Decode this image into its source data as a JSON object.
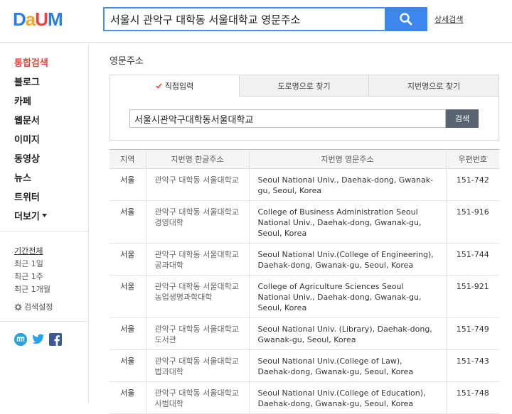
{
  "header": {
    "logo_letters": [
      "D",
      "a",
      "U",
      "M"
    ],
    "logo_colors": [
      "#2a7de1",
      "#f5a623",
      "#e8423f",
      "#2a7de1"
    ],
    "query": "서울시 관악구 대학동 서울대학교 영문주소",
    "detail_link": "상세검색",
    "accent": "#3d86ee"
  },
  "sidebar": {
    "nav": [
      {
        "label": "통합검색",
        "active": true
      },
      {
        "label": "블로그"
      },
      {
        "label": "카페"
      },
      {
        "label": "웹문서"
      },
      {
        "label": "이미지"
      },
      {
        "label": "동영상"
      },
      {
        "label": "뉴스"
      },
      {
        "label": "트위터"
      },
      {
        "label": "더보기"
      }
    ],
    "period_title": "기간전체",
    "periods": [
      "최근 1일",
      "최근 1주",
      "최근 1개월"
    ],
    "settings": "검색설정",
    "social_icons": [
      "mypeople-icon",
      "twitter-icon",
      "facebook-icon"
    ]
  },
  "main": {
    "section_title": "영문주소",
    "tabs": [
      {
        "label": "직접입력",
        "active": true
      },
      {
        "label": "도로명으로 찾기"
      },
      {
        "label": "지번명으로 찾기"
      }
    ],
    "address_input": "서울시관악구대학동서울대학교",
    "search_button": "검색",
    "table": {
      "headers": [
        "지역",
        "지번명 한글주소",
        "지번명 영문주소",
        "우편번호"
      ],
      "rows": [
        [
          "서울",
          "관악구 대학동 서울대학교",
          "Seoul National Univ., Daehak-dong, Gwanak-gu, Seoul, Korea",
          "151-742"
        ],
        [
          "서울",
          "관악구 대학동 서울대학교경영대학",
          "College of Business Administration Seoul National Univ., Daehak-dong, Gwanak-gu, Seoul, Korea",
          "151-916"
        ],
        [
          "서울",
          "관악구 대학동 서울대학교공과대학",
          "Seoul National Univ.(College of Engineering), Daehak-dong, Gwanak-gu, Seoul, Korea",
          "151-744"
        ],
        [
          "서울",
          "관악구 대학동 서울대학교농업생명과학대학",
          "College of Agriculture Sciences Seoul National Univ., Daehak-dong, Gwanak-gu, Seoul, Korea",
          "151-921"
        ],
        [
          "서울",
          "관악구 대학동 서울대학교도서관",
          "Seoul National Univ. (Library), Daehak-dong, Gwanak-gu, Seoul, Korea",
          "151-749"
        ],
        [
          "서울",
          "관악구 대학동 서울대학교법과대학",
          "Seoul National Univ.(College of Law), Daehak-dong, Gwanak-gu, Seoul, Korea",
          "151-743"
        ],
        [
          "서울",
          "관악구 대학동 서울대학교사범대학",
          "Seoul National Univ.(College of Education), Daehak-dong, Gwanak-gu, Seoul, Korea",
          "151-748"
        ]
      ]
    }
  }
}
